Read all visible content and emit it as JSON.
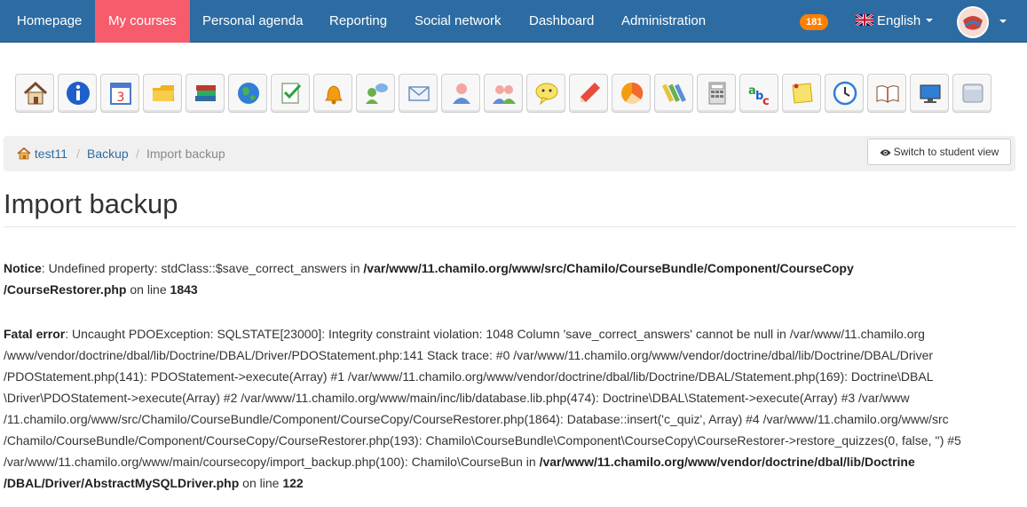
{
  "nav": {
    "items": [
      "Homepage",
      "My courses",
      "Personal agenda",
      "Reporting",
      "Social network",
      "Dashboard",
      "Administration"
    ],
    "badge": "181",
    "language": "English"
  },
  "toolbar": {
    "icons": [
      "home-icon",
      "info-icon",
      "calendar-icon",
      "folder-icon",
      "books-icon",
      "globe-icon",
      "checklist-icon",
      "bell-icon",
      "chat-user-icon",
      "envelope-icon",
      "user-icon",
      "group-icon",
      "speech-bubble-icon",
      "pencil-icon",
      "pie-chart-icon",
      "markers-icon",
      "calculator-icon",
      "abc-icon",
      "sticky-note-icon",
      "clock-icon",
      "open-book-icon",
      "monitor-icon",
      "tile-icon"
    ]
  },
  "breadcrumb": {
    "course": "test11",
    "section": "Backup",
    "current": "Import backup"
  },
  "student_view_label": "Switch to student view",
  "page_title": "Import backup",
  "notice": {
    "label": "Notice",
    "text": ": Undefined property: stdClass::$save_correct_answers in ",
    "path_1": "/var/www/11.chamilo.org/www/src/Chamilo/CourseBundle/Component/CourseCopy",
    "path_2": "/CourseRestorer.php",
    "on_line": " on line ",
    "line_no": "1843"
  },
  "fatal": {
    "label": "Fatal error",
    "line_1": ": Uncaught PDOException: SQLSTATE[23000]: Integrity constraint violation: 1048 Column 'save_correct_answers' cannot be null in /var/www/11.chamilo.org",
    "line_2": "/www/vendor/doctrine/dbal/lib/Doctrine/DBAL/Driver/PDOStatement.php:141 Stack trace: #0 /var/www/11.chamilo.org/www/vendor/doctrine/dbal/lib/Doctrine/DBAL/Driver",
    "line_3": "/PDOStatement.php(141): PDOStatement->execute(Array) #1 /var/www/11.chamilo.org/www/vendor/doctrine/dbal/lib/Doctrine/DBAL/Statement.php(169): Doctrine\\DBAL",
    "line_4": "\\Driver\\PDOStatement->execute(Array) #2 /var/www/11.chamilo.org/www/main/inc/lib/database.lib.php(474): Doctrine\\DBAL\\Statement->execute(Array) #3 /var/www",
    "line_5": "/11.chamilo.org/www/src/Chamilo/CourseBundle/Component/CourseCopy/CourseRestorer.php(1864): Database::insert('c_quiz', Array) #4 /var/www/11.chamilo.org/www/src",
    "line_6": "/Chamilo/CourseBundle/Component/CourseCopy/CourseRestorer.php(193): Chamilo\\CourseBundle\\Component\\CourseCopy\\CourseRestorer->restore_quizzes(0, false, '') #5",
    "line_7a": "/var/www/11.chamilo.org/www/main/coursecopy/import_backup.php(100): Chamilo\\CourseBun in ",
    "line_7b": "/var/www/11.chamilo.org/www/vendor/doctrine/dbal/lib/Doctrine",
    "line_8": "/DBAL/Driver/AbstractMySQLDriver.php",
    "on_line": " on line ",
    "line_no": "122"
  },
  "colors": {
    "navbar": "#2c6ca2",
    "active_tab": "#f65c6c",
    "badge": "#ff7f00",
    "link": "#2c6ca2"
  }
}
